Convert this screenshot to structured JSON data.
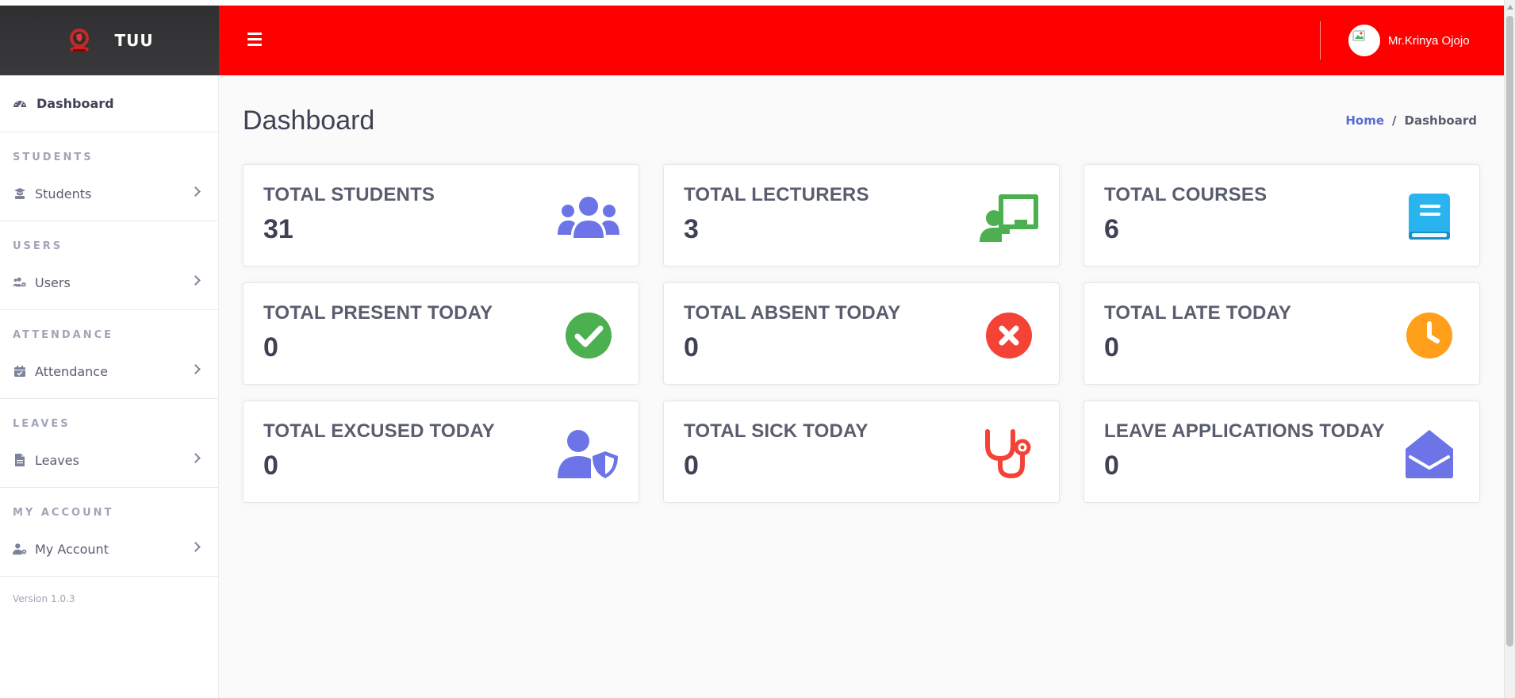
{
  "brand": {
    "name": "TUU",
    "logo_icon": "university-logo",
    "bg_color": "#333335"
  },
  "header": {
    "bg_color": "#ff0000",
    "menu_icon": "hamburger-icon",
    "user": {
      "name": "Mr.Krinya Ojojo",
      "avatar_icon": "broken-image-avatar"
    }
  },
  "sidebar": {
    "dashboard": {
      "label": "Dashboard",
      "icon": "tachometer-icon"
    },
    "sections": [
      {
        "title": "STUDENTS",
        "item": {
          "label": "Students",
          "icon": "graduate-icon"
        }
      },
      {
        "title": "USERS",
        "item": {
          "label": "Users",
          "icon": "users-cog-icon"
        }
      },
      {
        "title": "ATTENDANCE",
        "item": {
          "label": "Attendance",
          "icon": "calendar-check-icon"
        }
      },
      {
        "title": "LEAVES",
        "item": {
          "label": "Leaves",
          "icon": "file-icon"
        }
      },
      {
        "title": "MY ACCOUNT",
        "item": {
          "label": "My Account",
          "icon": "user-cog-icon"
        }
      }
    ],
    "version": "Version 1.0.3"
  },
  "main": {
    "title": "Dashboard",
    "breadcrumb": {
      "home": "Home",
      "separator": "/",
      "current": "Dashboard"
    },
    "cards": [
      {
        "title": "TOTAL STUDENTS",
        "value": "31",
        "icon": "users-icon",
        "color": "#6c74e8"
      },
      {
        "title": "TOTAL LECTURERS",
        "value": "3",
        "icon": "chalkboard-teacher-icon",
        "color": "#4caf50"
      },
      {
        "title": "TOTAL COURSES",
        "value": "6",
        "icon": "book-icon",
        "color": "#2ab4ef"
      },
      {
        "title": "TOTAL PRESENT TODAY",
        "value": "0",
        "icon": "check-circle-icon",
        "color": "#4caf50"
      },
      {
        "title": "TOTAL ABSENT TODAY",
        "value": "0",
        "icon": "times-circle-icon",
        "color": "#f44336"
      },
      {
        "title": "TOTAL LATE TODAY",
        "value": "0",
        "icon": "clock-icon",
        "color": "#ff9f1c"
      },
      {
        "title": "TOTAL EXCUSED TODAY",
        "value": "0",
        "icon": "user-shield-icon",
        "color": "#6c74e8"
      },
      {
        "title": "TOTAL SICK TODAY",
        "value": "0",
        "icon": "stethoscope-icon",
        "color": "#f44336"
      },
      {
        "title": "LEAVE APPLICATIONS TODAY",
        "value": "0",
        "icon": "envelope-open-icon",
        "color": "#6c74e8"
      }
    ]
  }
}
